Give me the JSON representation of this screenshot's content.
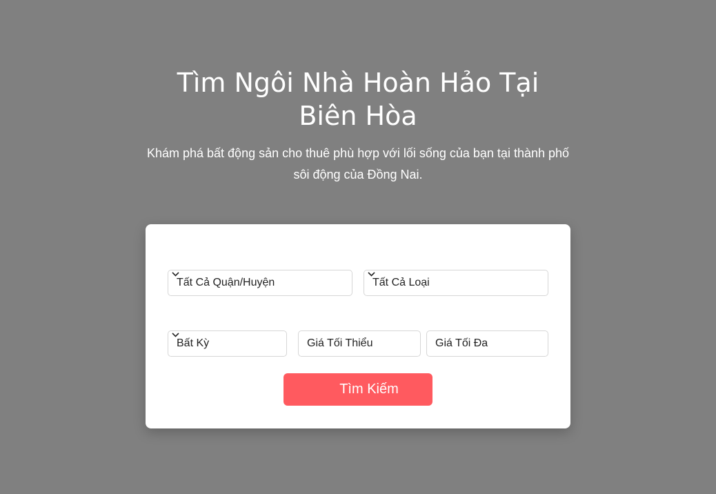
{
  "hero": {
    "title": "Tìm Ngôi Nhà Hoàn Hảo Tại Biên Hòa",
    "subtitle": "Khám phá bất động sản cho thuê phù hợp với lối sống của bạn tại thành phố sôi động của Đồng Nai."
  },
  "search": {
    "district": {
      "selected": "Tất Cả Quận/Huyện",
      "icon": "chevron-down-icon"
    },
    "property_type": {
      "selected": "Tất Cả Loại",
      "icon": "chevron-down-icon"
    },
    "bedrooms": {
      "selected": "Bất Kỳ",
      "icon": "chevron-down-icon"
    },
    "min_price": {
      "value": "",
      "placeholder": "Giá Tối Thiểu"
    },
    "max_price": {
      "value": "",
      "placeholder": "Giá Tối Đa"
    },
    "submit_label": "Tìm Kiếm"
  },
  "colors": {
    "background": "#808080",
    "card": "#ffffff",
    "accent": "#ff5a5f",
    "text_light": "#ffffff",
    "text_dark": "#222222"
  }
}
